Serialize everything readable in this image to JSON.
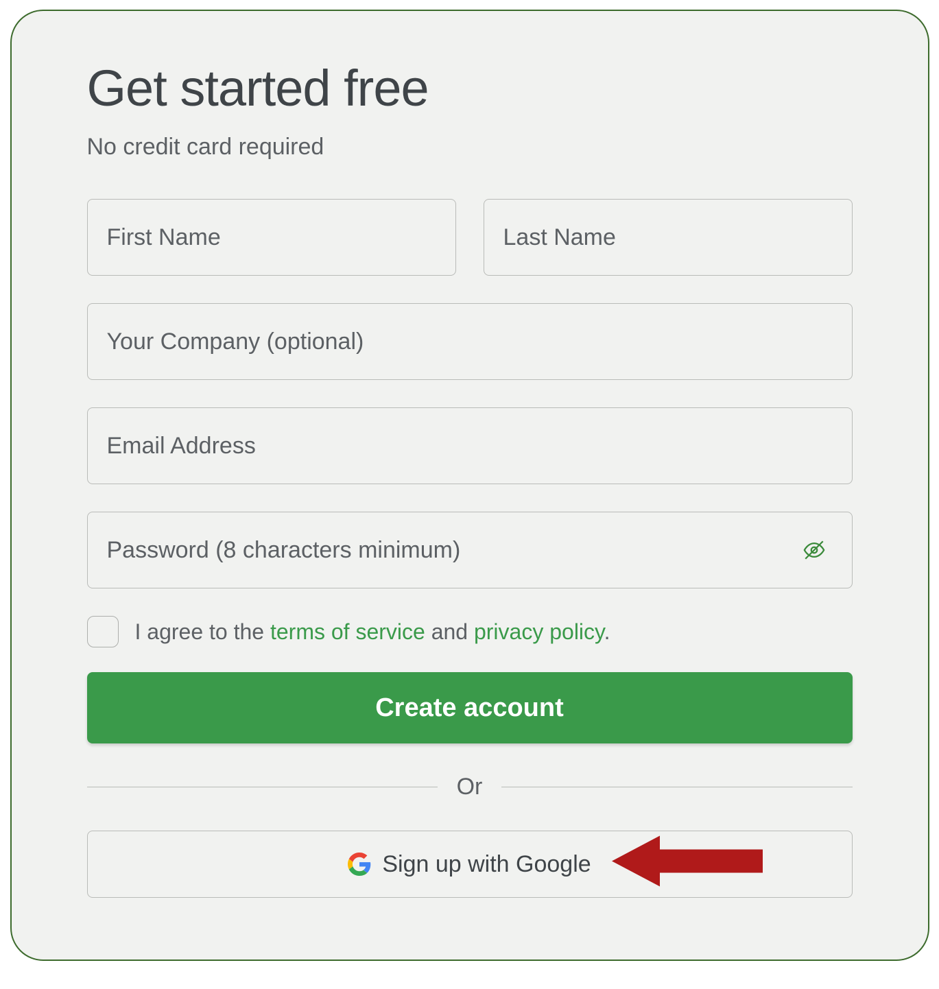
{
  "title": "Get started free",
  "subtitle": "No credit card required",
  "fields": {
    "first_name_placeholder": "First Name",
    "last_name_placeholder": "Last Name",
    "company_placeholder": "Your Company (optional)",
    "email_placeholder": "Email Address",
    "password_placeholder": "Password (8 characters minimum)"
  },
  "agree": {
    "prefix": "I agree to the ",
    "terms_link": "terms of service",
    "middle": " and ",
    "privacy_link": "privacy policy",
    "suffix": "."
  },
  "submit_label": "Create account",
  "divider_label": "Or",
  "google_label": "Sign up with Google"
}
